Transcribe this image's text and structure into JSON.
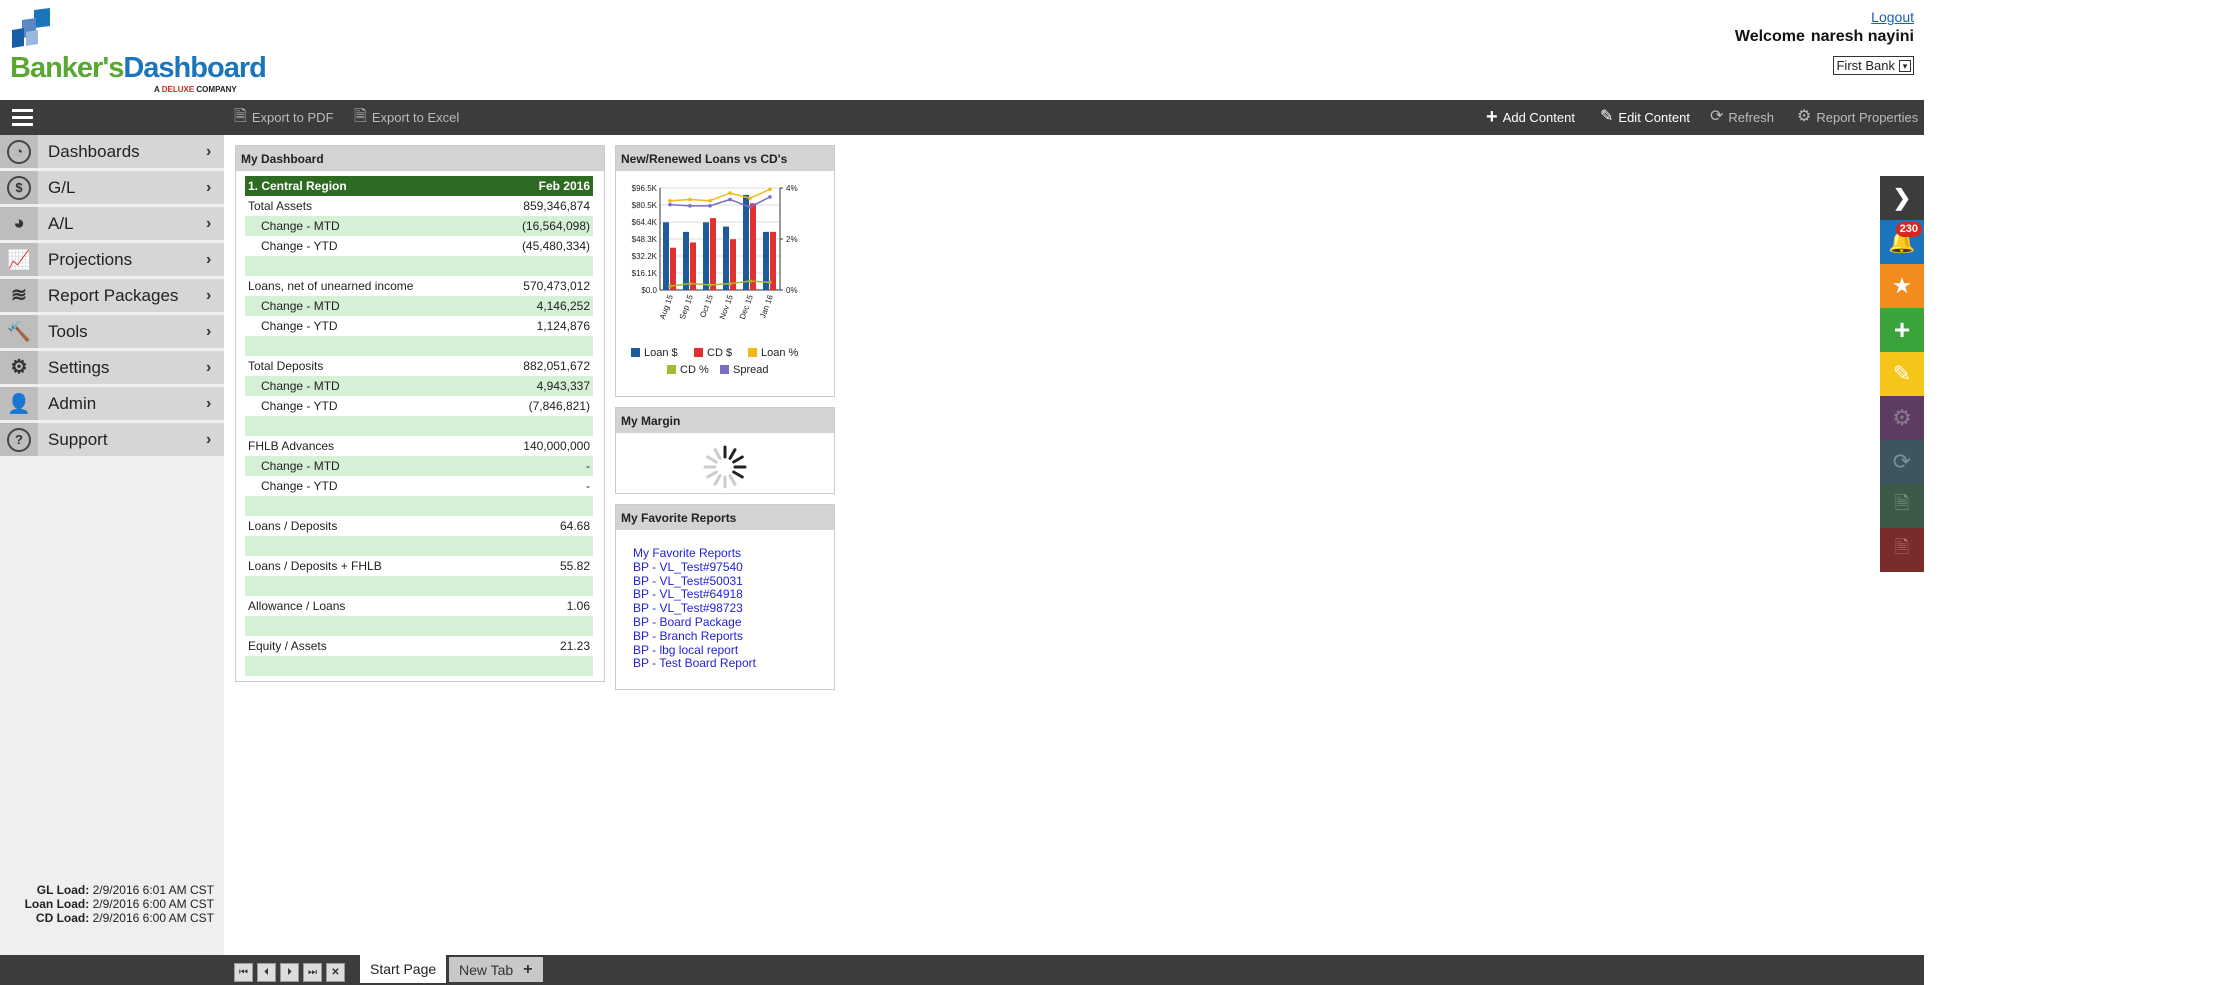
{
  "header": {
    "logo_brand_part1": "Banker's",
    "logo_brand_part2": "Dashboard",
    "logo_sub_part1": "A",
    "logo_sub_part2": "DELUXE",
    "logo_sub_part3": "COMPANY",
    "logout": "Logout",
    "welcome_label": "Welcome",
    "user_name": "naresh nayini",
    "bank_selected": "First Bank"
  },
  "toolbar": {
    "export_pdf": "Export to PDF",
    "export_excel": "Export to Excel",
    "add_content": "Add Content",
    "edit_content": "Edit Content",
    "refresh": "Refresh",
    "report_properties": "Report Properties"
  },
  "sidebar": {
    "items": [
      {
        "label": "Dashboards",
        "icon": "dashboard-gauge-icon"
      },
      {
        "label": "G/L",
        "icon": "dollar-circle-icon"
      },
      {
        "label": "A/L",
        "icon": "pie-chart-icon"
      },
      {
        "label": "Projections",
        "icon": "line-chart-icon"
      },
      {
        "label": "Report Packages",
        "icon": "layers-icon"
      },
      {
        "label": "Tools",
        "icon": "hammer-icon"
      },
      {
        "label": "Settings",
        "icon": "gear-icon"
      },
      {
        "label": "Admin",
        "icon": "user-icon"
      },
      {
        "label": "Support",
        "icon": "question-circle-icon"
      }
    ],
    "loads": [
      {
        "label": "GL Load:",
        "value": "2/9/2016 6:01 AM CST"
      },
      {
        "label": "Loan Load:",
        "value": "2/9/2016 6:00 AM CST"
      },
      {
        "label": "CD Load:",
        "value": "2/9/2016 6:00 AM CST"
      }
    ]
  },
  "dashboard": {
    "title": "My Dashboard",
    "region": "1. Central Region",
    "period": "Feb 2016",
    "rows": [
      {
        "label": "Total Assets",
        "value": "859,346,874",
        "indent": false,
        "green": false
      },
      {
        "label": "Change - MTD",
        "value": "(16,564,098)",
        "indent": true,
        "green": true
      },
      {
        "label": "Change - YTD",
        "value": "(45,480,334)",
        "indent": true,
        "green": false
      },
      {
        "label": "",
        "value": "",
        "indent": false,
        "green": true
      },
      {
        "label": "Loans, net of unearned income",
        "value": "570,473,012",
        "indent": false,
        "green": false
      },
      {
        "label": "Change - MTD",
        "value": "4,146,252",
        "indent": true,
        "green": true
      },
      {
        "label": "Change - YTD",
        "value": "1,124,876",
        "indent": true,
        "green": false
      },
      {
        "label": "",
        "value": "",
        "indent": false,
        "green": true
      },
      {
        "label": "Total Deposits",
        "value": "882,051,672",
        "indent": false,
        "green": false
      },
      {
        "label": "Change - MTD",
        "value": "4,943,337",
        "indent": true,
        "green": true
      },
      {
        "label": "Change - YTD",
        "value": "(7,846,821)",
        "indent": true,
        "green": false
      },
      {
        "label": "",
        "value": "",
        "indent": false,
        "green": true
      },
      {
        "label": "FHLB Advances",
        "value": "140,000,000",
        "indent": false,
        "green": false
      },
      {
        "label": "Change - MTD",
        "value": "-",
        "indent": true,
        "green": true
      },
      {
        "label": "Change - YTD",
        "value": "-",
        "indent": true,
        "green": false
      },
      {
        "label": "",
        "value": "",
        "indent": false,
        "green": true
      },
      {
        "label": "Loans / Deposits",
        "value": "64.68",
        "indent": false,
        "green": false
      },
      {
        "label": "",
        "value": "",
        "indent": false,
        "green": true
      },
      {
        "label": "Loans / Deposits + FHLB",
        "value": "55.82",
        "indent": false,
        "green": false
      },
      {
        "label": "",
        "value": "",
        "indent": false,
        "green": true
      },
      {
        "label": "Allowance / Loans",
        "value": "1.06",
        "indent": false,
        "green": false
      },
      {
        "label": "",
        "value": "",
        "indent": false,
        "green": true
      },
      {
        "label": "Equity / Assets",
        "value": "21.23",
        "indent": false,
        "green": false
      },
      {
        "label": "",
        "value": "",
        "indent": false,
        "green": true
      }
    ]
  },
  "chart_panel": {
    "title": "New/Renewed Loans vs CD's"
  },
  "chart_data": {
    "type": "bar",
    "title": "",
    "categories": [
      "Aug 15",
      "Sep 15",
      "Oct 15",
      "Nov 15",
      "Dec 15",
      "Jan 16"
    ],
    "y_ticks": [
      "$0.0",
      "$16.1K",
      "$32.2K",
      "$48.3K",
      "$64.4K",
      "$80.5K",
      "$96.5K"
    ],
    "y2_ticks": [
      "0%",
      "2%",
      "4%"
    ],
    "ylim": [
      0,
      96.5
    ],
    "y2lim": [
      0,
      4
    ],
    "series": [
      {
        "name": "Loan $",
        "type": "bar",
        "color": "#1f5b9b",
        "values": [
          64,
          55,
          64,
          60,
          90,
          55
        ]
      },
      {
        "name": "CD $",
        "type": "bar",
        "color": "#e03030",
        "values": [
          40,
          45,
          68,
          48,
          82,
          55
        ]
      },
      {
        "name": "Loan %",
        "type": "line",
        "color": "#f3b716",
        "values": [
          3.5,
          3.55,
          3.5,
          3.8,
          3.6,
          3.95
        ]
      },
      {
        "name": "CD %",
        "type": "line",
        "color": "#a8b832",
        "values": [
          0.15,
          0.25,
          0.2,
          0.25,
          0.35,
          0.3
        ]
      },
      {
        "name": "Spread",
        "type": "line",
        "color": "#7a6fc0",
        "values": [
          3.35,
          3.3,
          3.3,
          3.55,
          3.25,
          3.65
        ]
      }
    ],
    "legend": "bottom"
  },
  "margin_panel": {
    "title": "My Margin"
  },
  "favorites": {
    "title": "My Favorite Reports",
    "items": [
      "My Favorite Reports",
      "BP - VL_Test#97540",
      "BP - VL_Test#50031",
      "BP - VL_Test#64918",
      "BP - VL_Test#98723",
      "BP - Board Package",
      "BP - Branch Reports",
      "BP - lbg local report",
      "BP - Test Board Report"
    ]
  },
  "rightbar": {
    "notification_count": "230",
    "colors": [
      "#3c3c3c",
      "#1c75bc",
      "#f28c1e",
      "#3aa33a",
      "#f6c51a",
      "#5d3c62",
      "#3e5560",
      "#3d5a48",
      "#7a2b2b"
    ]
  },
  "bottom": {
    "tab_start": "Start Page",
    "tab_new": "New Tab"
  }
}
